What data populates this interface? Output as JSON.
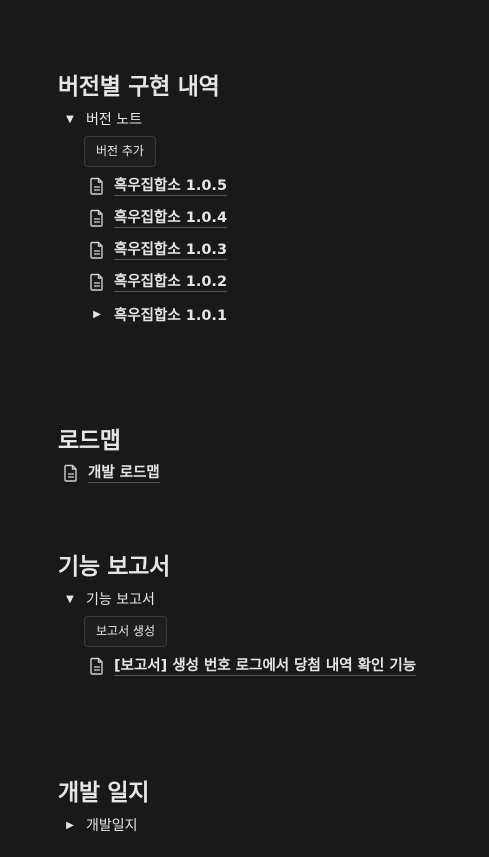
{
  "sections": {
    "versions": {
      "title": "버전별 구현 내역",
      "toggle_label": "버전 노트",
      "button_label": "버전 추가",
      "pages": [
        "흑우집합소 1.0.5",
        "흑우집합소 1.0.4",
        "흑우집합소 1.0.3",
        "흑우집합소 1.0.2"
      ],
      "collapsed_item": "흑우집합소 1.0.1"
    },
    "roadmap": {
      "title": "로드맵",
      "page": "개발 로드맵"
    },
    "reports": {
      "title": "기능 보고서",
      "toggle_label": "기능 보고서",
      "button_label": "보고서 생성",
      "page": "[보고서] 생성 번호 로그에서 당첨 내역 확인 기능"
    },
    "devlog": {
      "title": "개발 일지",
      "toggle_label": "개발일지"
    }
  },
  "icons": {
    "expanded": "triangle-down-icon",
    "collapsed": "triangle-right-icon",
    "page": "document-icon"
  }
}
